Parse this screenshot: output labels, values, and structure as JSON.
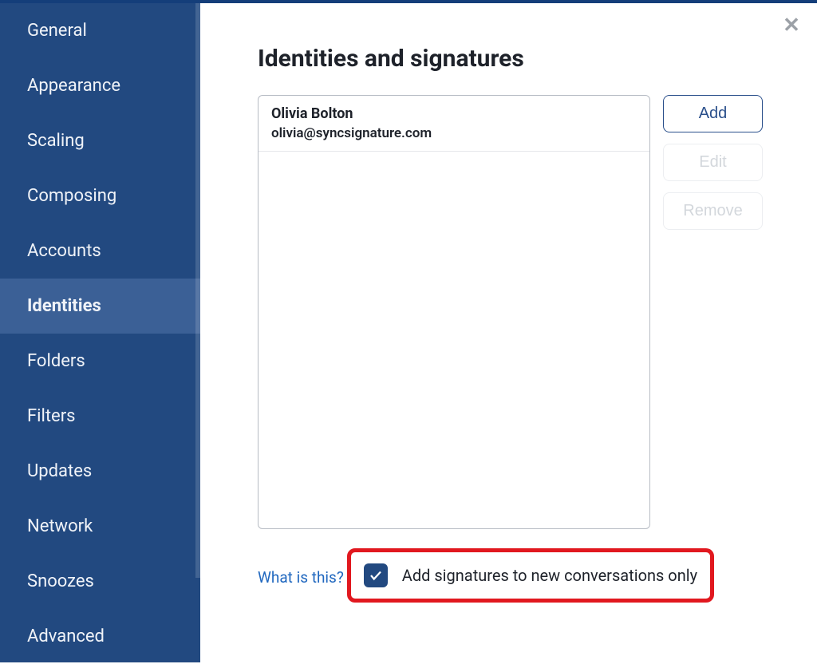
{
  "sidebar": {
    "items": [
      {
        "label": "General"
      },
      {
        "label": "Appearance"
      },
      {
        "label": "Scaling"
      },
      {
        "label": "Composing"
      },
      {
        "label": "Accounts"
      },
      {
        "label": "Identities",
        "active": true
      },
      {
        "label": "Folders"
      },
      {
        "label": "Filters"
      },
      {
        "label": "Updates"
      },
      {
        "label": "Network"
      },
      {
        "label": "Snoozes"
      },
      {
        "label": "Advanced"
      }
    ]
  },
  "main": {
    "title": "Identities and signatures",
    "identities": [
      {
        "name": "Olivia Bolton",
        "email": "olivia@syncsignature.com"
      }
    ],
    "buttons": {
      "add": "Add",
      "edit": "Edit",
      "remove": "Remove"
    },
    "help_link": "What is this?",
    "checkbox": {
      "label": "Add signatures to new conversations only",
      "checked": true
    }
  }
}
